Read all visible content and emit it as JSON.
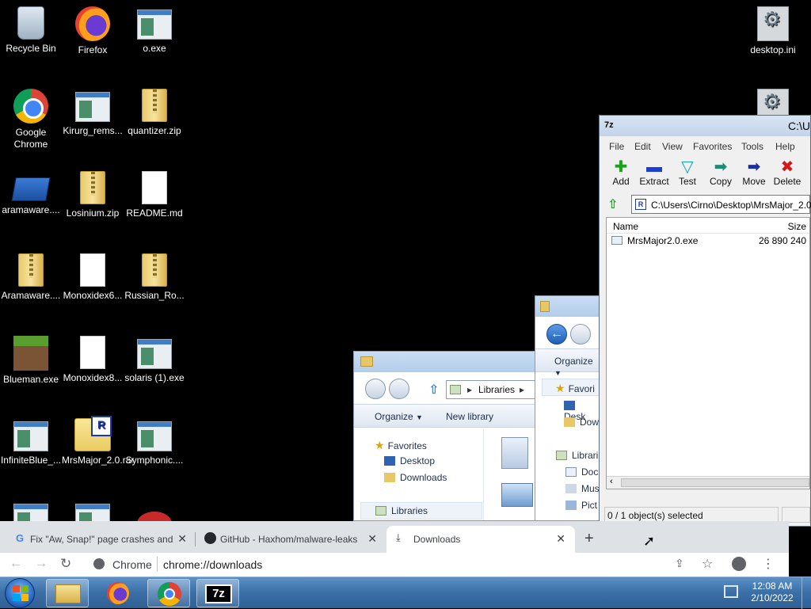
{
  "desktop": {
    "icons": [
      {
        "label": "Recycle Bin",
        "icon": "recycle-bin-icon"
      },
      {
        "label": "Firefox",
        "icon": "firefox-icon"
      },
      {
        "label": "o.exe",
        "icon": "exe-icon"
      },
      {
        "label": "desktop.ini",
        "icon": "settings-file-icon"
      },
      {
        "label": "Google Chrome",
        "icon": "chrome-icon"
      },
      {
        "label": "Kirurg_rems...",
        "icon": "exe-icon"
      },
      {
        "label": "quantizer.zip",
        "icon": "zip-icon"
      },
      {
        "label": "aramaware....",
        "icon": "shortcut-icon"
      },
      {
        "label": "Losinium.zip",
        "icon": "zip-icon"
      },
      {
        "label": "README.md",
        "icon": "document-icon"
      },
      {
        "label": "Aramaware....",
        "icon": "zip-icon"
      },
      {
        "label": "Monoxidex6...",
        "icon": "document-icon"
      },
      {
        "label": "Russian_Ro...",
        "icon": "zip-icon"
      },
      {
        "label": "Blueman.exe",
        "icon": "minecraft-icon"
      },
      {
        "label": "Monoxidex8...",
        "icon": "document-icon"
      },
      {
        "label": "solaris (1).exe",
        "icon": "exe-icon"
      },
      {
        "label": "InfiniteBlue_...",
        "icon": "exe-icon"
      },
      {
        "label": "MrsMajor_2.0.rar",
        "icon": "rar-icon"
      },
      {
        "label": "Symphonic....",
        "icon": "exe-icon"
      }
    ]
  },
  "explorer_libraries": {
    "breadcrumb": "Libraries",
    "organize": "Organize",
    "new_library": "New library",
    "nav": {
      "favorites": "Favorites",
      "desktop": "Desktop",
      "downloads": "Downloads",
      "libraries": "Libraries"
    }
  },
  "explorer_back": {
    "organize": "Organize",
    "nav": {
      "favorites": "Favori",
      "desktop": "Desk",
      "downloads": "Dow",
      "libraries": "Librari",
      "documents": "Doc",
      "music": "Mus",
      "pictures": "Pict"
    }
  },
  "sevenzip": {
    "title": "C:\\U",
    "logo": "7z",
    "menu": [
      "File",
      "Edit",
      "View",
      "Favorites",
      "Tools",
      "Help"
    ],
    "toolbar": [
      {
        "label": "Add",
        "icon": "add-icon",
        "color": "#1aa31a",
        "glyph": "✚"
      },
      {
        "label": "Extract",
        "icon": "extract-icon",
        "color": "#1a3fd1",
        "glyph": "▬"
      },
      {
        "label": "Test",
        "icon": "test-icon",
        "color": "#17a3b6",
        "glyph": "▽"
      },
      {
        "label": "Copy",
        "icon": "copy-icon",
        "color": "#1f8a7a",
        "glyph": "➡"
      },
      {
        "label": "Move",
        "icon": "move-icon",
        "color": "#1f2f9a",
        "glyph": "➡"
      },
      {
        "label": "Delete",
        "icon": "delete-icon",
        "color": "#d11a1a",
        "glyph": "✖"
      }
    ],
    "address": "C:\\Users\\Cirno\\Desktop\\MrsMajor_2.0.",
    "columns": {
      "name": "Name",
      "size": "Size"
    },
    "files": [
      {
        "name": "MrsMajor2.0.exe",
        "size": "26 890 240"
      }
    ],
    "status": "0 / 1 object(s) selected"
  },
  "chrome": {
    "tabs": [
      {
        "title": "Fix \"Aw, Snap!\" page crashes and",
        "icon": "google-icon"
      },
      {
        "title": "GitHub - Haxhom/malware-leaks",
        "icon": "github-icon"
      },
      {
        "title": "Downloads",
        "icon": "download-icon"
      }
    ],
    "omnibox": {
      "site": "Chrome",
      "url": "chrome://downloads"
    }
  },
  "taskbar": {
    "time": "12:08 AM",
    "date": "2/10/2022",
    "sevenzip_label": "7z"
  }
}
